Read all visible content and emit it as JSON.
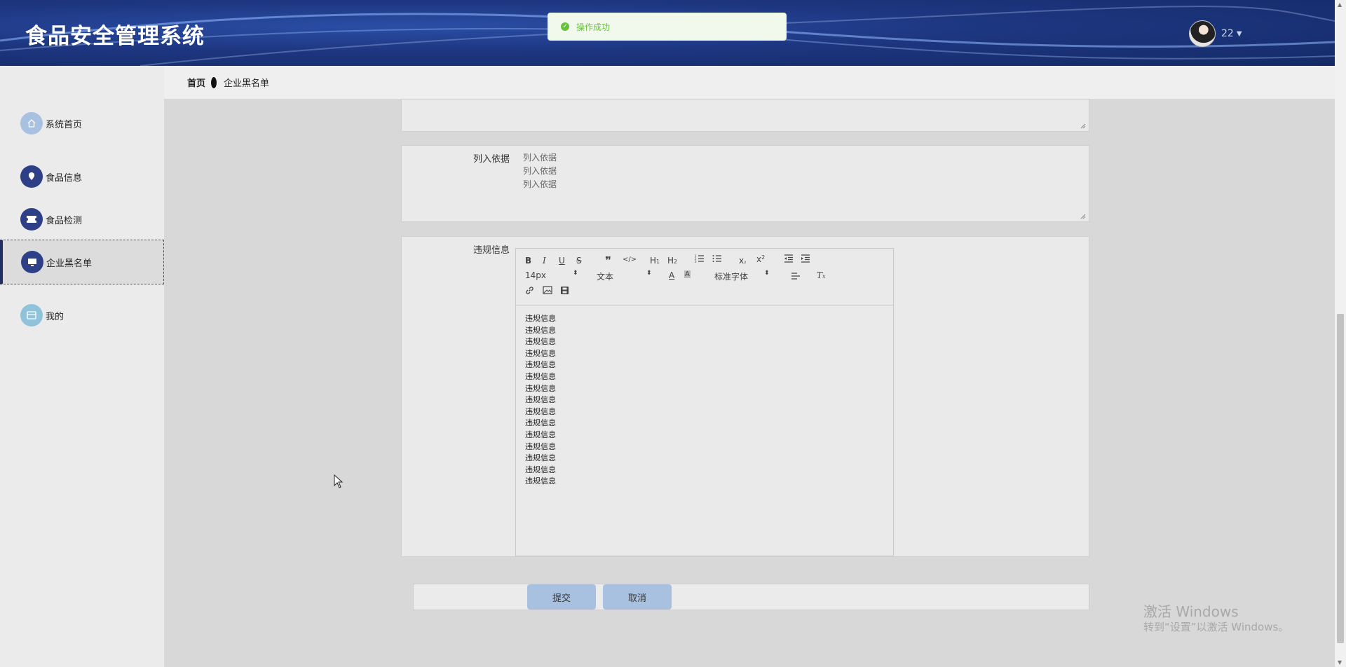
{
  "header": {
    "app_title": "食品安全管理系统",
    "username": "22",
    "caret": "▼"
  },
  "toast": {
    "message": "操作成功",
    "icon": "check-circle-icon",
    "color": "#67c23a"
  },
  "breadcrumb": {
    "home": "首页",
    "current": "企业黑名单"
  },
  "sidebar": {
    "items": [
      {
        "label": "系统首页",
        "icon": "home-icon",
        "icon_color": "#a9c1e0"
      },
      {
        "label": "食品信息",
        "icon": "location-pin-icon",
        "icon_color": "#2d3f86"
      },
      {
        "label": "食品检测",
        "icon": "ticket-icon",
        "icon_color": "#2d3f86"
      },
      {
        "label": "企业黑名单",
        "icon": "monitor-icon",
        "icon_color": "#2d3f86",
        "active": true
      },
      {
        "label": "我的",
        "icon": "card-icon",
        "icon_color": "#8fc3dc"
      }
    ]
  },
  "form": {
    "basis": {
      "label": "列入依据",
      "lines": [
        "列入依据",
        "列入依据",
        "列入依据"
      ]
    },
    "violation": {
      "label": "违规信息",
      "toolbar": {
        "font_size": "14px",
        "text_style": "文本",
        "font_family": "标准字体"
      },
      "lines": [
        "违规信息",
        "违规信息",
        "违规信息",
        "违规信息",
        "违规信息",
        "违规信息",
        "违规信息",
        "违规信息",
        "违规信息",
        "违规信息",
        "违规信息",
        "违规信息",
        "违规信息",
        "违规信息",
        "违规信息"
      ]
    },
    "submit_label": "提交",
    "cancel_label": "取消"
  },
  "watermark": {
    "line1": "激活 Windows",
    "line2": "转到“设置”以激活 Windows。"
  },
  "colors": {
    "header_bg": "#1d3680",
    "button_bg": "#a9c1e0",
    "nav_icon": "#2d3f86"
  }
}
